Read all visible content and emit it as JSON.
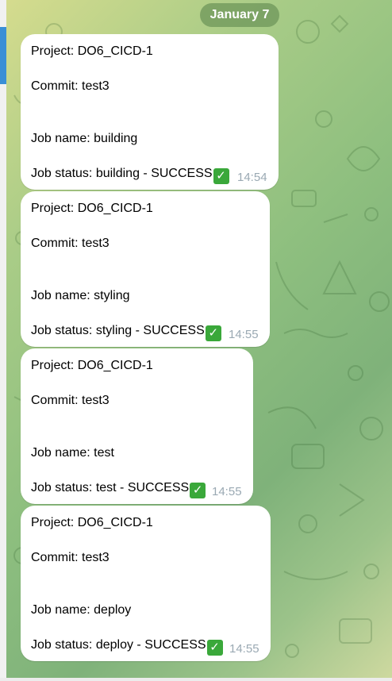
{
  "chat": {
    "date": "January 7",
    "messages": [
      {
        "project": "Project: DO6_CICD-1",
        "commit": "Commit: test3",
        "job_name": "Job name: building",
        "job_status": "Job status: building - SUCCESS",
        "status_icon": "check-mark-icon",
        "time": "14:54"
      },
      {
        "project": "Project: DO6_CICD-1",
        "commit": "Commit: test3",
        "job_name": "Job name: styling",
        "job_status": "Job status: styling - SUCCESS",
        "status_icon": "check-mark-icon",
        "time": "14:55"
      },
      {
        "project": "Project: DO6_CICD-1",
        "commit": "Commit: test3",
        "job_name": "Job name: test",
        "job_status": "Job status: test - SUCCESS",
        "status_icon": "check-mark-icon",
        "time": "14:55"
      },
      {
        "project": "Project: DO6_CICD-1",
        "commit": "Commit: test3",
        "job_name": "Job name: deploy",
        "job_status": "Job status: deploy - SUCCESS",
        "status_icon": "check-mark-icon",
        "time": "14:55"
      }
    ]
  },
  "colors": {
    "bubble": "#ffffff",
    "time": "#9aa9b3",
    "accent": "#3a8fd6",
    "check": "#3aa83a"
  }
}
